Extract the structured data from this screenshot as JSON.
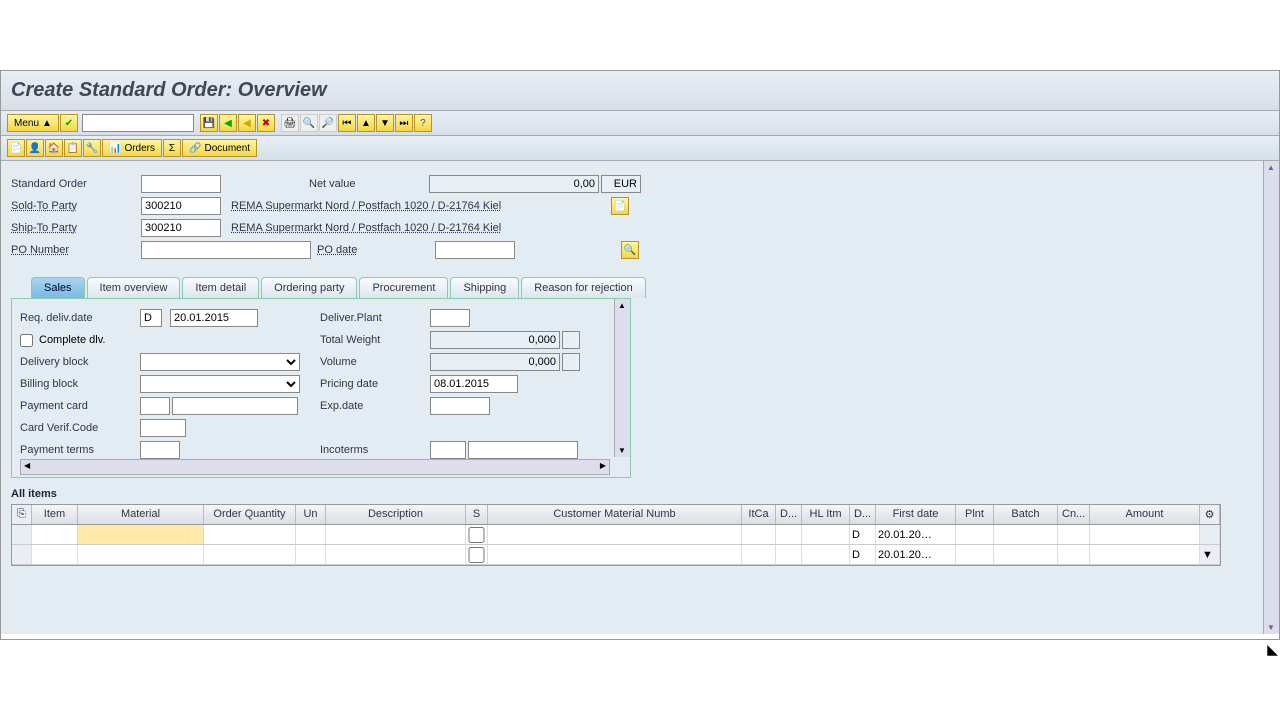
{
  "page_title": "Create Standard Order: Overview",
  "menu_label": "Menu",
  "toolbar2": {
    "orders": "Orders",
    "document": "Document"
  },
  "header": {
    "standard_order_label": "Standard Order",
    "standard_order": "",
    "net_value_label": "Net value",
    "net_value": "0,00",
    "currency": "EUR",
    "sold_to_label": "Sold-To Party",
    "sold_to": "300210",
    "sold_to_text": "REMA Supermarkt Nord / Postfach 1020 / D-21764 Kiel",
    "ship_to_label": "Ship-To Party",
    "ship_to": "300210",
    "ship_to_text": "REMA Supermarkt Nord / Postfach 1020 / D-21764 Kiel",
    "po_number_label": "PO Number",
    "po_number": "",
    "po_date_label": "PO date",
    "po_date": ""
  },
  "tabs": [
    "Sales",
    "Item overview",
    "Item detail",
    "Ordering party",
    "Procurement",
    "Shipping",
    "Reason for rejection"
  ],
  "sales": {
    "req_deliv_date_label": "Req. deliv.date",
    "req_deliv_type": "D",
    "req_deliv_date": "20.01.2015",
    "deliver_plant_label": "Deliver.Plant",
    "deliver_plant": "",
    "complete_dlv_label": "Complete dlv.",
    "total_weight_label": "Total Weight",
    "total_weight": "0,000",
    "delivery_block_label": "Delivery block",
    "volume_label": "Volume",
    "volume": "0,000",
    "billing_block_label": "Billing block",
    "pricing_date_label": "Pricing date",
    "pricing_date": "08.01.2015",
    "payment_card_label": "Payment card",
    "exp_date_label": "Exp.date",
    "card_verif_label": "Card Verif.Code",
    "payment_terms_label": "Payment terms",
    "incoterms_label": "Incoterms"
  },
  "items_section_title": "All items",
  "table": {
    "cols": [
      "",
      "Item",
      "Material",
      "Order Quantity",
      "Un",
      "Description",
      "S",
      "Customer Material Numb",
      "ItCa",
      "D...",
      "HL Itm",
      "D...",
      "First date",
      "Plnt",
      "Batch",
      "Cn...",
      "Amount",
      ""
    ],
    "rows": [
      {
        "d": "D",
        "first_date": "20.01.20…"
      },
      {
        "d": "D",
        "first_date": "20.01.20…"
      }
    ]
  }
}
